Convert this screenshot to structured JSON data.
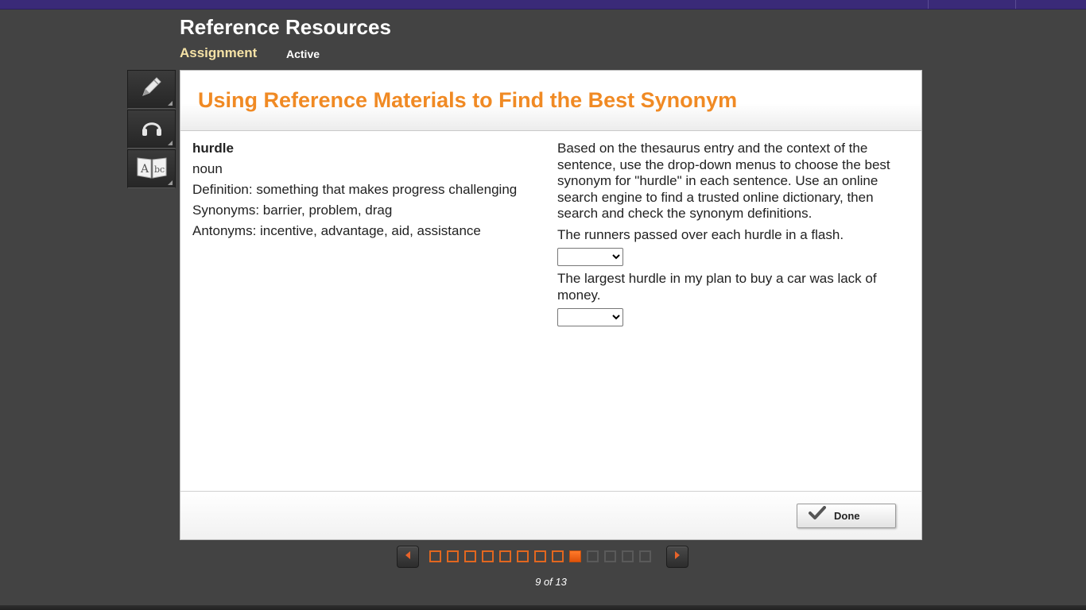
{
  "app": {
    "title": "Reference Resources",
    "tab_assignment": "Assignment",
    "status": "Active"
  },
  "toolbar": {
    "tools": [
      {
        "icon": "pencil-icon",
        "name": "highlighter"
      },
      {
        "icon": "headphones-icon",
        "name": "audio"
      },
      {
        "icon": "dictionary-icon",
        "name": "dictionary"
      }
    ]
  },
  "activity": {
    "title": "Using Reference Materials to Find the Best Synonym",
    "entry": {
      "word": "hurdle",
      "part_of_speech": "noun",
      "definition": "Definition: something that makes progress challenging",
      "synonyms": "Synonyms: barrier, problem, drag",
      "antonyms": "Antonyms: incentive, advantage, aid, assistance"
    },
    "instructions": "Based on the thesaurus entry and the context of the sentence, use the drop-down menus to choose the best synonym for \"hurdle\" in each sentence. Use an online search engine to find a trusted online dictionary, then search and check the synonym definitions.",
    "questions": [
      {
        "sentence": "The runners passed over each hurdle in a flash.",
        "selected": ""
      },
      {
        "sentence": "The largest hurdle in my plan to buy a car was lack of money.",
        "selected": ""
      }
    ]
  },
  "footer": {
    "done_label": "Done"
  },
  "pager": {
    "current": 9,
    "total": 13,
    "label": "9 of 13"
  },
  "colors": {
    "accent": "#f08a24",
    "top_bar": "#3a2a78",
    "background": "#434343"
  }
}
